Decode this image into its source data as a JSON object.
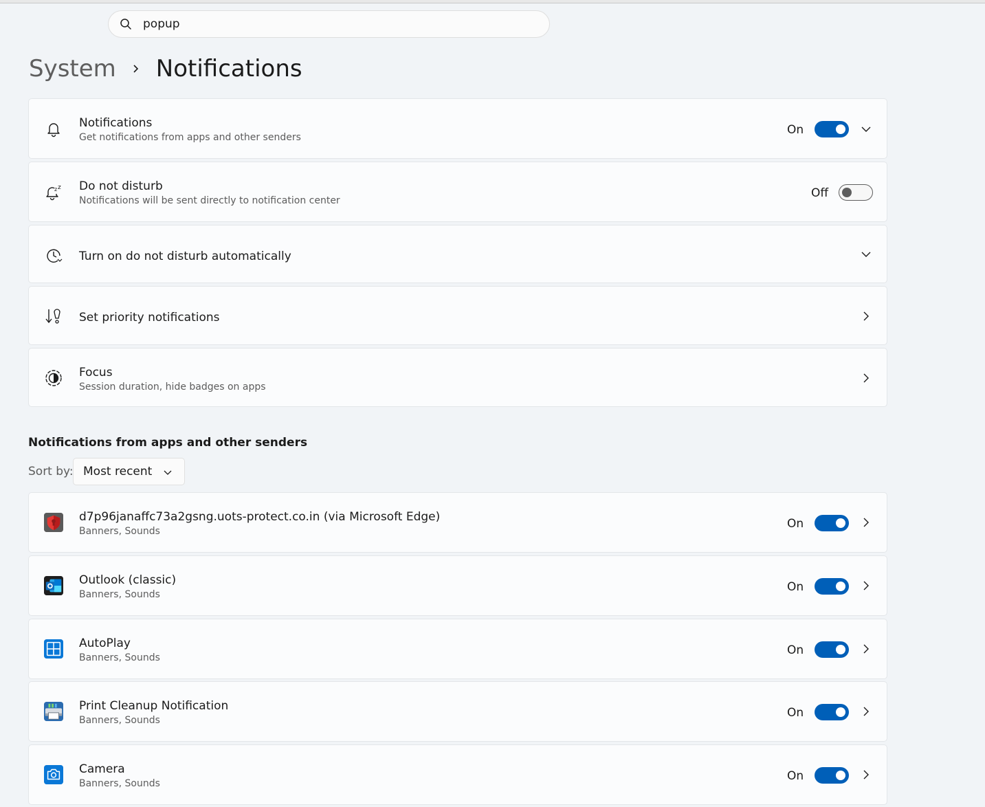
{
  "search": {
    "value": "popup"
  },
  "breadcrumb": {
    "parent": "System",
    "current": "Notifications"
  },
  "settings": [
    {
      "title": "Notifications",
      "subtitle": "Get notifications from apps and other senders",
      "state": "On"
    },
    {
      "title": "Do not disturb",
      "subtitle": "Notifications will be sent directly to notification center",
      "state": "Off"
    },
    {
      "title": "Turn on do not disturb automatically"
    },
    {
      "title": "Set priority notifications"
    },
    {
      "title": "Focus",
      "subtitle": "Session duration, hide badges on apps"
    }
  ],
  "apps_section": {
    "title": "Notifications from apps and other senders",
    "sort_label": "Sort by:",
    "sort_value": "Most recent"
  },
  "apps": [
    {
      "title": "d7p96janaffc73a2gsng.uots-protect.co.in (via Microsoft Edge)",
      "subtitle": "Banners, Sounds",
      "state": "On",
      "icon": "shield-icon"
    },
    {
      "title": "Outlook (classic)",
      "subtitle": "Banners, Sounds",
      "state": "On",
      "icon": "outlook-icon"
    },
    {
      "title": "AutoPlay",
      "subtitle": "Banners, Sounds",
      "state": "On",
      "icon": "autoplay-icon"
    },
    {
      "title": "Print Cleanup Notification",
      "subtitle": "Banners, Sounds",
      "state": "On",
      "icon": "printer-icon"
    },
    {
      "title": "Camera",
      "subtitle": "Banners, Sounds",
      "state": "On",
      "icon": "camera-icon"
    }
  ]
}
